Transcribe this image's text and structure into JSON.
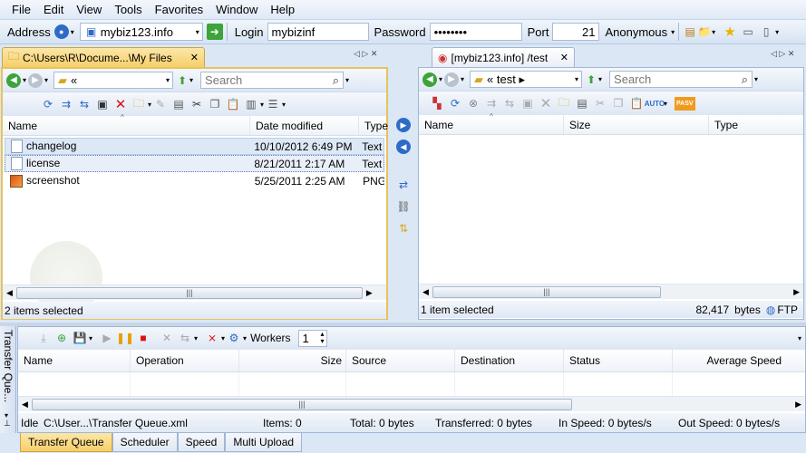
{
  "menu": [
    "File",
    "Edit",
    "View",
    "Tools",
    "Favorites",
    "Window",
    "Help"
  ],
  "connect": {
    "address_label": "Address",
    "address_value": "mybiz123.info",
    "login_label": "Login",
    "login_value": "mybizinf",
    "password_label": "Password",
    "password_value": "••••••••",
    "port_label": "Port",
    "port_value": "21",
    "anonymous_label": "Anonymous"
  },
  "left": {
    "tab_title": "C:\\Users\\R\\Docume...\\My Files",
    "path_text": "«",
    "search_placeholder": "Search",
    "columns": [
      "Name",
      "Date modified",
      "Type"
    ],
    "files": [
      {
        "name": "changelog",
        "date": "10/10/2012 6:49 PM",
        "type": "Text"
      },
      {
        "name": "license",
        "date": "8/21/2011 2:17 AM",
        "type": "Text"
      },
      {
        "name": "screenshot",
        "date": "5/25/2011 2:25 AM",
        "type": "PNG"
      }
    ],
    "status": "2 items selected"
  },
  "right": {
    "tab_title": "[mybiz123.info] /test",
    "path_text": "« test ▸",
    "search_placeholder": "Search",
    "columns": [
      "Name",
      "Size",
      "Type"
    ],
    "status": "1 item selected",
    "bytes": "82,417",
    "bytes_label": "bytes",
    "protocol": "FTP",
    "pasv": "PASV",
    "auto": "AUTO"
  },
  "queue": {
    "side_label": "Transfer Que...",
    "workers_label": "Workers",
    "workers_value": "1",
    "columns": [
      "Name",
      "Operation",
      "Size",
      "Source",
      "Destination",
      "Status",
      "Average Speed"
    ],
    "status": {
      "state": "Idle",
      "file": "C:\\User...\\Transfer Queue.xml",
      "items": "Items: 0",
      "total": "Total: 0 bytes",
      "transferred": "Transferred: 0 bytes",
      "in_speed": "In Speed: 0 bytes/s",
      "out_speed": "Out Speed: 0 bytes/s"
    }
  },
  "bottom_tabs": [
    "Transfer Queue",
    "Scheduler",
    "Speed",
    "Multi Upload"
  ],
  "colors": {
    "accent": "#f6cf6a",
    "panel_border": "#9fb6d6",
    "bg": "#dce7f5"
  }
}
